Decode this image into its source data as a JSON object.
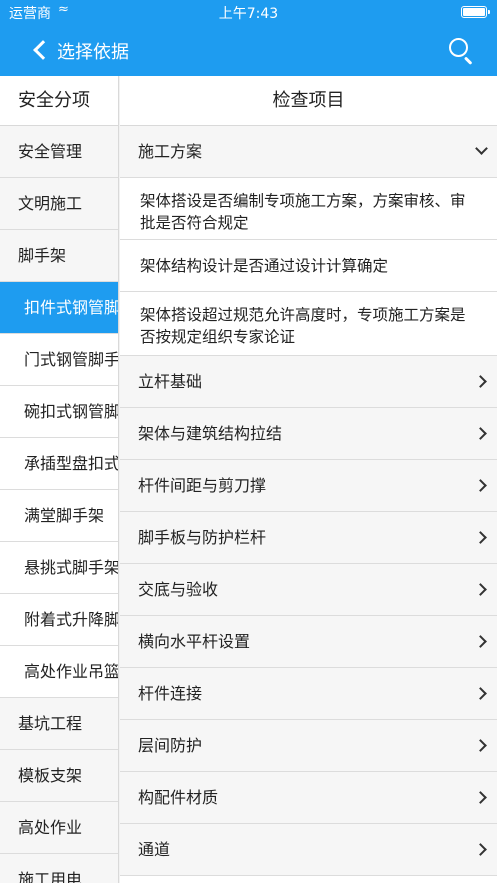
{
  "status": {
    "carrier": "运营商",
    "time": "上午7:43"
  },
  "nav": {
    "back_label": "选择依据"
  },
  "left": {
    "header": "安全分项",
    "items": [
      {
        "label": "安全管理",
        "level": 0
      },
      {
        "label": "文明施工",
        "level": 0
      },
      {
        "label": "脚手架",
        "level": 0
      },
      {
        "label": "扣件式钢管脚手架",
        "level": 1,
        "active": true
      },
      {
        "label": "门式钢管脚手架",
        "level": 1
      },
      {
        "label": "碗扣式钢管脚手架",
        "level": 1
      },
      {
        "label": "承插型盘扣式钢管脚手架",
        "level": 1
      },
      {
        "label": "满堂脚手架",
        "level": 1
      },
      {
        "label": "悬挑式脚手架",
        "level": 1
      },
      {
        "label": "附着式升降脚手架",
        "level": 1
      },
      {
        "label": "高处作业吊篮",
        "level": 1
      },
      {
        "label": "基坑工程",
        "level": 0
      },
      {
        "label": "模板支架",
        "level": 0
      },
      {
        "label": "高处作业",
        "level": 0
      },
      {
        "label": "施工用电",
        "level": 0
      }
    ]
  },
  "right": {
    "header": "检查项目",
    "expanded_group": "施工方案",
    "expanded_items": [
      "架体搭设是否编制专项施工方案，方案审核、审批是否符合规定",
      "架体结构设计是否通过设计计算确定",
      "架体搭设超过规范允许高度时，专项施工方案是否按规定组织专家论证"
    ],
    "groups": [
      "立杆基础",
      "架体与建筑结构拉结",
      "杆件间距与剪刀撑",
      "脚手板与防护栏杆",
      "交底与验收",
      "横向水平杆设置",
      "杆件连接",
      "层间防护",
      "构配件材质",
      "通道"
    ]
  },
  "colors": {
    "accent": "#1e9cf0"
  }
}
